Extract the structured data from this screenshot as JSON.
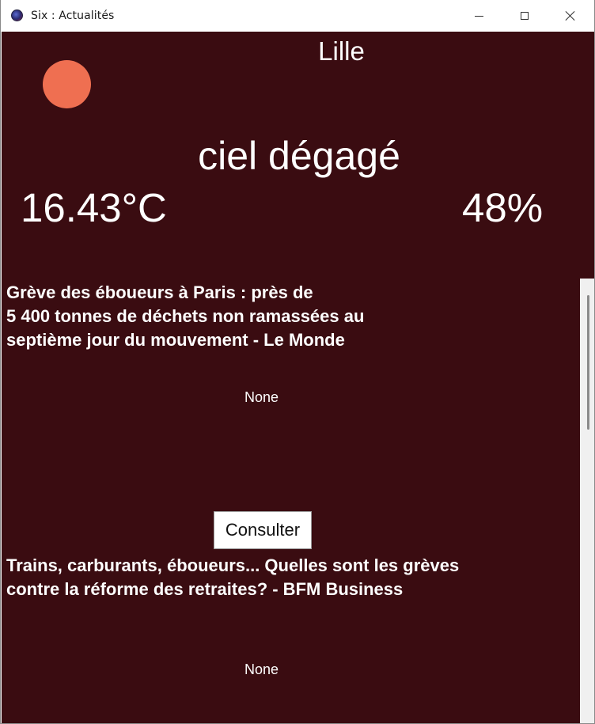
{
  "window": {
    "title": "Six : Actualités",
    "app_icon": "app-globe-icon",
    "controls": [
      "minimize-icon",
      "maximize-icon",
      "close-icon"
    ]
  },
  "weather": {
    "city": "Lille",
    "icon": "sun-icon",
    "icon_color": "#ef6f51",
    "condition": "ciel dégagé",
    "temperature": "16.43°C",
    "humidity": "48%"
  },
  "articles": [
    {
      "title": "Grève des éboueurs à Paris : près de\n5 400 tonnes de déchets non ramassées au\nseptième jour du mouvement - Le Monde",
      "description": "None"
    },
    {
      "title": "Trains, carburants, éboueurs... Quelles sont les grèves\ncontre la réforme des retraites? - BFM Business",
      "description": "None"
    }
  ],
  "consult_button_label": "Consulter",
  "colors": {
    "background": "#3a0c11",
    "text": "#ffffff",
    "button_bg": "#ffffff"
  }
}
